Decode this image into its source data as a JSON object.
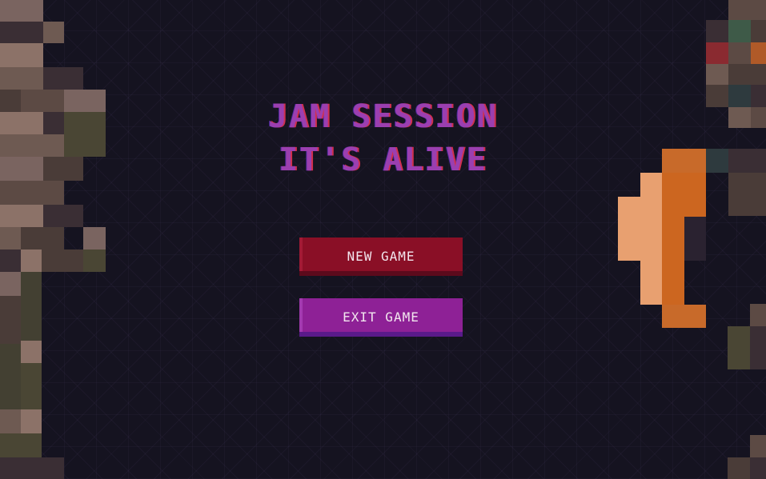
{
  "title": {
    "line1": "JAM SESSION",
    "line2": "IT'S ALIVE"
  },
  "menu": {
    "new_game": "NEW GAME",
    "exit_game": "EXIT GAME"
  },
  "colors": {
    "background": "#151320",
    "title": "#9b3fb0",
    "title_shadow": "#d0304e",
    "new_game_button": "#8a0f26",
    "exit_game_button": "#8e2196",
    "button_text": "#f2e6ee",
    "orange_sprite": "#cc6620"
  }
}
